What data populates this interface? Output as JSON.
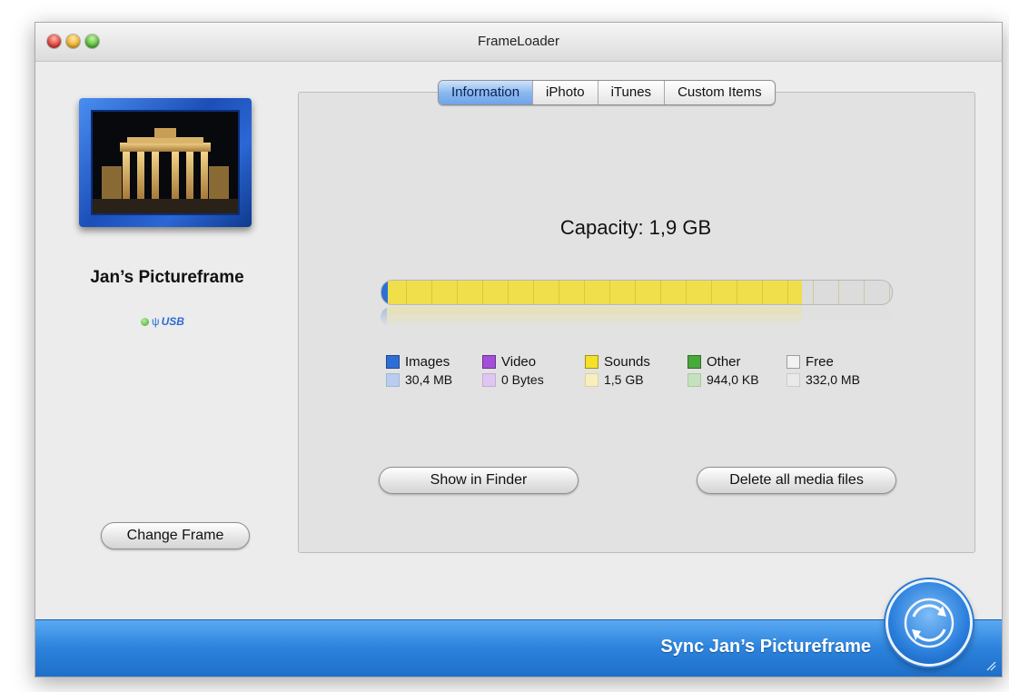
{
  "window": {
    "title": "FrameLoader"
  },
  "device": {
    "name": "Jan’s Pictureframe",
    "connection": "USB",
    "change_frame_label": "Change Frame"
  },
  "tabs": [
    {
      "label": "Information",
      "active": true
    },
    {
      "label": "iPhoto",
      "active": false
    },
    {
      "label": "iTunes",
      "active": false
    },
    {
      "label": "Custom Items",
      "active": false
    }
  ],
  "info": {
    "capacity_label": "Capacity: 1,9 GB",
    "usage": {
      "segments": [
        {
          "name": "Images",
          "fraction": 0.013,
          "color": "#2e6fd6"
        },
        {
          "name": "Video",
          "fraction": 0.0,
          "color": "#a44fd8"
        },
        {
          "name": "Sounds",
          "fraction": 0.81,
          "color": "#f0de4a"
        },
        {
          "name": "Other",
          "fraction": 0.0005,
          "color": "#4aa83c"
        },
        {
          "name": "Free",
          "fraction": 0.1765,
          "color": "#dcdcdc"
        }
      ]
    },
    "legend": [
      {
        "label": "Images",
        "size": "30,4 MB",
        "color": "#2e6fd6",
        "light_color": "#b9cdf1"
      },
      {
        "label": "Video",
        "size": "0 Bytes",
        "color": "#a44fd8",
        "light_color": "#dfc6f2"
      },
      {
        "label": "Sounds",
        "size": "1,5 GB",
        "color": "#f5e02a",
        "light_color": "#f7efbd"
      },
      {
        "label": "Other",
        "size": "944,0 KB",
        "color": "#48a83a",
        "light_color": "#c4e2bd"
      },
      {
        "label": "Free",
        "size": "332,0 MB",
        "color": "#f2f2f2",
        "light_color": "#e9e9e9"
      }
    ],
    "show_in_finder_label": "Show in Finder",
    "delete_all_label": "Delete all media files"
  },
  "sync": {
    "label": "Sync Jan’s Pictureframe",
    "icon": "sync-arrows-icon"
  }
}
